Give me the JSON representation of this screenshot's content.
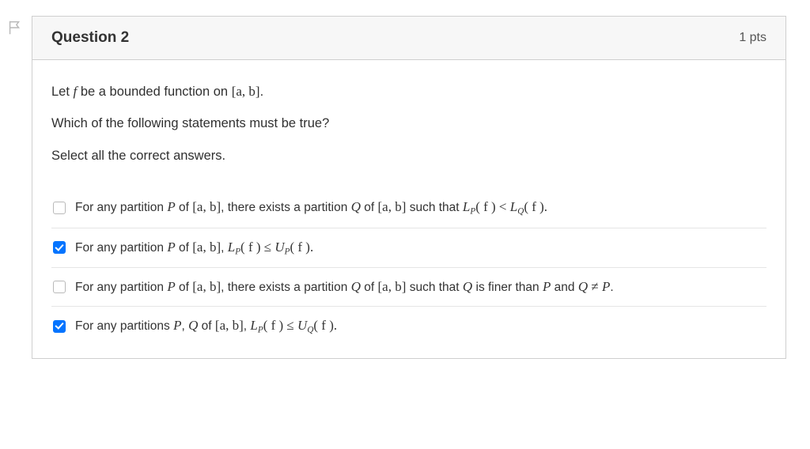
{
  "header": {
    "title": "Question 2",
    "points": "1 pts"
  },
  "prompt": {
    "line1_pre": "Let ",
    "line1_f": "f",
    "line1_mid": " be a bounded function on ",
    "line1_interval": "[a, b]",
    "line1_post": ".",
    "line2": "Which of the following statements must be true?",
    "line3": "Select all the correct answers."
  },
  "options": [
    {
      "checked": false,
      "name": "option-1",
      "pre": "For any partition ",
      "P": "P",
      "mid1": " of ",
      "ab1": "[a, b]",
      "mid2": ", there exists a partition ",
      "Q": "Q",
      "mid3": " of ",
      "ab2": "[a, b]",
      "mid4": " such that ",
      "lp": "L",
      "lp_sub": "P",
      "lp_arg": "( f ) < ",
      "lq": "L",
      "lq_sub": "Q",
      "lq_arg": "( f ).",
      "tail": ""
    },
    {
      "checked": true,
      "name": "option-2",
      "pre": "For any partition ",
      "P": "P",
      "mid1": " of ",
      "ab1": "[a, b]",
      "mid2": ",  ",
      "lp": "L",
      "lp_sub": "P",
      "lp_arg": "( f ) ≤ ",
      "up": "U",
      "up_sub": "P",
      "up_arg": "( f ).",
      "tail": ""
    },
    {
      "checked": false,
      "name": "option-3",
      "pre": "For any partition ",
      "P": "P",
      "mid1": " of ",
      "ab1": "[a, b]",
      "mid2": ", there exists a partition ",
      "Q": "Q",
      "mid3": " of ",
      "ab2": "[a, b]",
      "mid4": " such that ",
      "Q2": "Q",
      "mid5": " is finer than ",
      "P2": "P",
      "mid6": " and ",
      "Q3": "Q",
      "neq": " ≠ ",
      "P3": "P",
      "dot": "."
    },
    {
      "checked": true,
      "name": "option-4",
      "pre": "For any partitions ",
      "P": "P",
      "comma": ", ",
      "Q": "Q",
      "mid1": " of ",
      "ab1": "[a, b]",
      "mid2": ", ",
      "lp": "L",
      "lp_sub": "P",
      "lp_arg": "( f ) ≤ ",
      "uq": "U",
      "uq_sub": "Q",
      "uq_arg": "( f ).",
      "tail": ""
    }
  ]
}
